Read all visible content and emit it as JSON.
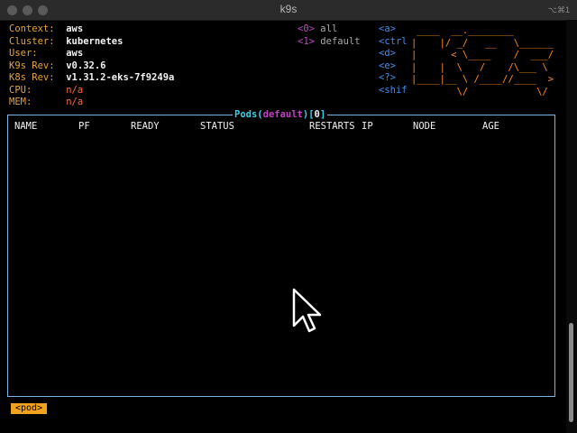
{
  "window": {
    "title": "k9s",
    "title_key_hint": "⌥⌘1"
  },
  "info": [
    {
      "label": "Context:",
      "value": "aws",
      "style": "val"
    },
    {
      "label": "Cluster:",
      "value": "kubernetes",
      "style": "val"
    },
    {
      "label": "User:",
      "value": "aws",
      "style": "val"
    },
    {
      "label": "K9s Rev:",
      "value": "v0.32.6",
      "style": "val"
    },
    {
      "label": "K8s Rev:",
      "value": "v1.31.2-eks-7f9249a",
      "style": "val"
    },
    {
      "label": "CPU:",
      "value": "n/a",
      "style": "red"
    },
    {
      "label": "MEM:",
      "value": "n/a",
      "style": "red"
    }
  ],
  "namespaces": [
    {
      "key": "<0>",
      "name": "all"
    },
    {
      "key": "<1>",
      "name": "default"
    }
  ],
  "hotkeys": [
    "<a>",
    "<ctrl",
    "<d>",
    "<e>",
    "<?>",
    "<shif"
  ],
  "logo_lines": [
    " ____  __.________",
    "|    |/ _/   __   \\______",
    "|      < \\____    /  ___/",
    "|    |  \\   /    /\\___ \\",
    "|____|__ \\ /____//____  >",
    "        \\/            \\/"
  ],
  "table": {
    "resource": "Pods",
    "namespace": "default",
    "count": "0",
    "columns": [
      "NAME",
      "PF",
      "READY",
      "STATUS",
      "RESTARTS",
      "IP",
      "NODE",
      "AGE"
    ]
  },
  "breadcrumb": "<pod>",
  "colors": {
    "label": "#e8a33a",
    "value": "#f2f2f2",
    "warning": "#ff6a3d",
    "namespace_key": "#c540c7",
    "hotkey": "#3b8ef0",
    "logo": "#ff8c1a",
    "frame": "#7fb5e6",
    "title": "#38d0e6",
    "crumb_bg": "#f2a31d"
  }
}
